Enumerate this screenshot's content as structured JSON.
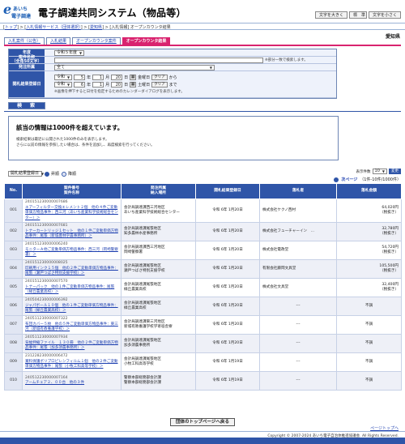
{
  "header": {
    "logo_mark": "e",
    "logo_line1": "あいち",
    "logo_line2": "電子調達",
    "title": "電子調達共同システム（物品等）",
    "font_btns": [
      "文字を大きく",
      "標　準",
      "文字を小さく"
    ]
  },
  "breadcrumb": {
    "top": "トップ",
    "sep1": " > ",
    "service": "入札情報サービス（団体選択）",
    "sep2": " > ",
    "pref_link": "愛知県",
    "sep3": " > ",
    "current": "[入札情報] オープンカウンタ結果",
    "prefecture": "愛知県"
  },
  "tabs": [
    "入札案件（公告）",
    "入札結果",
    "オープンカウンタ案件",
    "オープンカウンタ結果"
  ],
  "form": {
    "year_label": "年度",
    "year_value": "令和５年度",
    "name_label": "案件名称\n（全角50文字）",
    "name_value": "",
    "name_note": "※部分一致で検索します。",
    "dept_label": "発注所属",
    "dept_value": "全て",
    "date_label": "開札結果登録日",
    "from_era": "令和",
    "from_y": "5",
    "from_m": "1",
    "from_d": "20",
    "from_weekday": "金曜日",
    "from_suffix": "から",
    "to_era": "令和",
    "to_y": "6",
    "to_m": "1",
    "to_d": "20",
    "to_weekday": "土曜日",
    "to_suffix": "まで",
    "year_unit": "年",
    "month_unit": "月",
    "day_unit": "日",
    "cal_icon": "▦",
    "clear_label": "クリア",
    "date_note": "※画像を押下すると日付を指定するためのカレンダーダイアログを表示します。",
    "search_btn": "検　索"
  },
  "notice": {
    "headline": "該当の情報は1000件を超えています。",
    "line1": "検索結果は最近に公開された1000件のみを表示します。",
    "line2": "さらに以前の情報を参照したい場合は、条件を追加し、再度検索を行ってください。"
  },
  "controls": {
    "sort_value": "開札結果登録日",
    "sort_asc": "昇順",
    "sort_desc": "降順",
    "per_page_label": "表示件数",
    "per_page_value": "10",
    "per_page_btn": "変更",
    "pager_next": "次ページ",
    "pager_range": "（1件-10件/1000件）"
  },
  "table": {
    "headers": [
      "No.",
      "案件番号\n案件名称",
      "発注所属\n納入場所",
      "開札結果登録日",
      "落札者",
      "落札金額"
    ],
    "rows": [
      {
        "no": "001",
        "num": "240151230000007686",
        "name": "エアーフィルター交換エレメント２個　他の４件ご変動単価方物品事件：西三河（あいち産業科学技術総合センター）＞",
        "dept": "会計局調達課西三河地区",
        "place": "あいち産業科学技術総合センター",
        "date": "令和 6年 1月20日",
        "winner": "株式会社ケクノ西村",
        "amount": "64,020円",
        "tax": "（税抜き）"
      },
      {
        "no": "002",
        "num": "240151230000007681",
        "name": "トナーカートリッジ１セット　他の１件ご変動単価方物品事件：尾張（新城豊林学農事務所）＞",
        "dept": "会計局調達課尾張地区",
        "place": "知多農林水産事務所",
        "date": "令和 6年 1月20日",
        "winner": "株式会社フューチャーイン　...",
        "amount": "32,780円",
        "tax": "（税抜き）"
      },
      {
        "no": "003",
        "num": "240151230000006240",
        "name": "モニターＡ他ご変動単価方物品事件：西三河（岡崎警察署）＞",
        "dept": "会計局調達課西三河地区",
        "place": "岡崎警察署",
        "date": "令和 6年 1月20日",
        "winner": "株式会社電政堂",
        "amount": "54,720円",
        "tax": "（税抜き）"
      },
      {
        "no": "004",
        "num": "240151230000008025",
        "name": "印刷用インク１５個　他の２件ご変動単価方物品事件：尾張（瀬戸つばさ特別支援学校）＞",
        "dept": "会計局調達課尾張地区",
        "place": "瀬戸つばさ特別支援学校",
        "date": "令和 6年 1月20日",
        "winner": "有限会社藤岡文具堂",
        "amount": "105,500円",
        "tax": "（税抜き）"
      },
      {
        "no": "005",
        "num": "240151230000007570",
        "name": "トナーパック　他の１件ご変動単価方物品事件：尾張（緑丘農業高校）＞",
        "dept": "会計局調達課尾張地区",
        "place": "緑丘農業高校",
        "date": "令和 6年 1月20日",
        "winner": "株式会社文具堂",
        "amount": "32,400円",
        "tax": "（税抜き）"
      },
      {
        "no": "006",
        "num": "240504230000006392",
        "name": "ジャパボール１０個　他の１件ご変動単価方物品事件：尾張（緑丘農業高校）＞",
        "dept": "会計局調達課尾張地区",
        "place": "緑丘農業高校",
        "date": "令和 6年 1月20日",
        "winner": "---",
        "amount": "不調",
        "tax": ""
      },
      {
        "no": "007",
        "num": "240511230000007322",
        "name": "布団カバー５枚　他の５件ご変動単価方物品事件：東三河（新城有教養護学校）＞",
        "dept": "会計局調達課東三河地区",
        "place": "新城有教養護学校学寄宿舎寮",
        "date": "令和 6年 1月20日",
        "winner": "---",
        "amount": "不調",
        "tax": ""
      },
      {
        "no": "008",
        "num": "240511230000007934",
        "name": "背幅伸縮ファイル　１３０冊　他の２件ご変動単価方物品事件：尾張（加多須農事務所）＞",
        "dept": "会計局調達課尾張地区",
        "place": "加多須農事務所",
        "date": "令和 6年 1月20日",
        "winner": "---",
        "amount": "不調",
        "tax": ""
      },
      {
        "no": "009",
        "num": "231228230000006472",
        "name": "賞料保護ポリプロピレンフィルム１個　他の２件ご変動単価方物品事件：尾張（小牧工科高等学校）＞",
        "dept": "会計局調達課尾張地区",
        "place": "小牧工科高等学校",
        "date": "令和 6年 1月19日",
        "winner": "---",
        "amount": "不調",
        "tax": ""
      },
      {
        "no": "010",
        "num": "240512230000007164",
        "name": "アームチェア２、００台　他の３件",
        "dept": "警察本部総務部会計課",
        "place": "警察本部総務部会計課",
        "date": "令和 6年 1月19日",
        "winner": "---",
        "amount": "不調",
        "tax": ""
      }
    ]
  },
  "footer": {
    "top_btn": "団体のトップページへ戻る",
    "page_top": "ページトップへ",
    "copyright": "Copyright © 2007-2024 あいち電子自治体推進協議会. All Rights Reserved."
  },
  "colors": {
    "accent": "#d9236f",
    "primary": "#2f55a8"
  }
}
